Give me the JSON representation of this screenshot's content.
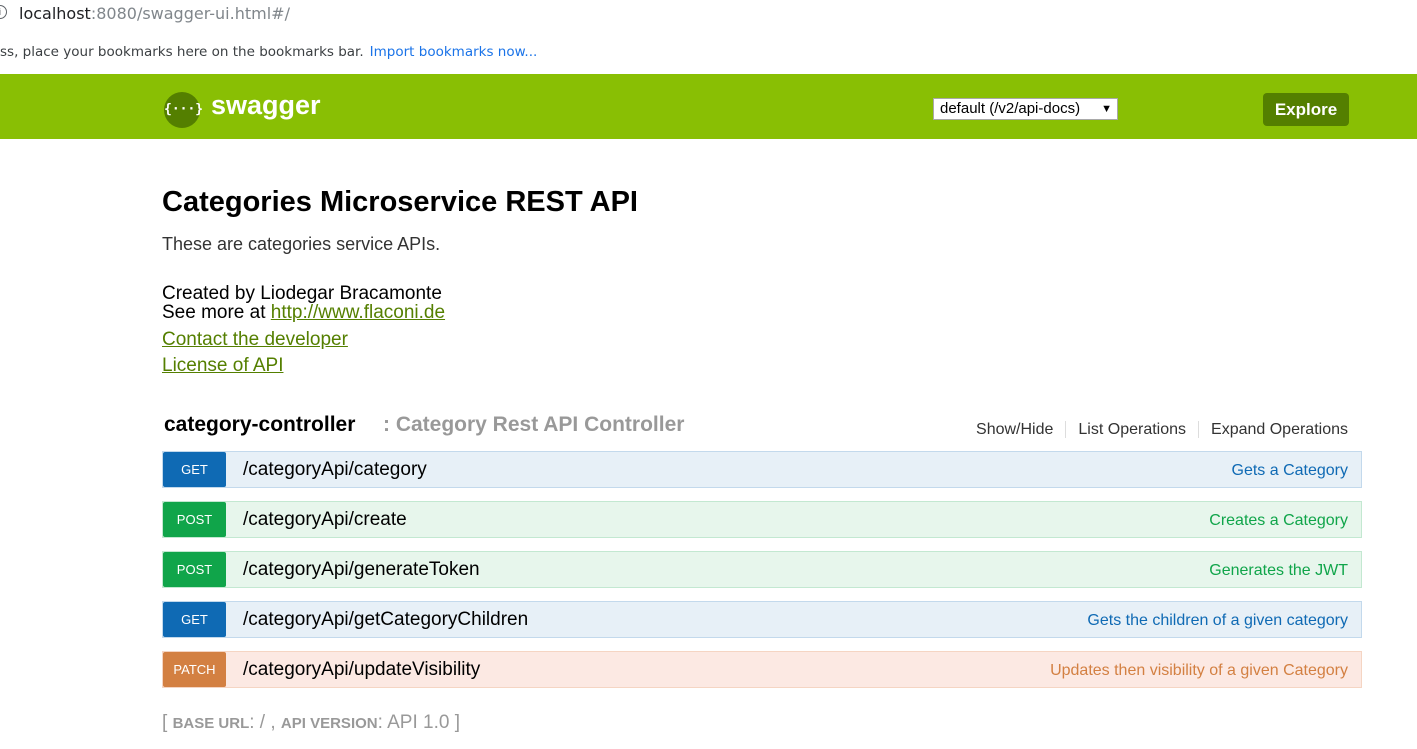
{
  "browser": {
    "url_host": "localhost",
    "url_rest": ":8080/swagger-ui.html#/",
    "bookmarks_text": "ss, place your bookmarks here on the bookmarks bar.",
    "bookmarks_link": "Import bookmarks now..."
  },
  "header": {
    "logo_icon": "{···}",
    "logo_text": "swagger",
    "spec_select": "default (/v2/api-docs)",
    "select_caret": "▼",
    "explore_label": "Explore"
  },
  "info": {
    "title": "Categories Microservice REST API",
    "description": "These are categories service APIs.",
    "created_by": "Created by Liodegar Bracamonte",
    "see_more_prefix": "See more at ",
    "see_more_link": "http://www.flaconi.de",
    "contact_link": "Contact the developer",
    "license_link": "License of API"
  },
  "resource": {
    "name": "category-controller",
    "description": ": Category Rest API Controller",
    "show_hide": "Show/Hide",
    "list_operations": "List Operations",
    "expand_operations": "Expand Operations",
    "operations": [
      {
        "method": "GET",
        "path": "/categoryApi/category",
        "summary": "Gets a Category"
      },
      {
        "method": "POST",
        "path": "/categoryApi/create",
        "summary": "Creates a Category"
      },
      {
        "method": "POST",
        "path": "/categoryApi/generateToken",
        "summary": "Generates the JWT"
      },
      {
        "method": "GET",
        "path": "/categoryApi/getCategoryChildren",
        "summary": "Gets the children of a given category"
      },
      {
        "method": "PATCH",
        "path": "/categoryApi/updateVisibility",
        "summary": "Updates then visibility of a given Category"
      }
    ]
  },
  "footer": {
    "open_bracket": "[ ",
    "base_url_label": "BASE URL",
    "base_url_value": ": / , ",
    "api_version_label": "API VERSION",
    "api_version_value": ": API 1.0 ",
    "close_bracket": "]"
  },
  "colors": {
    "header_bg": "#89bf04",
    "explore_bg": "#547f00",
    "get": "#0f6ab4",
    "post": "#10a54a",
    "patch": "#d38042"
  }
}
